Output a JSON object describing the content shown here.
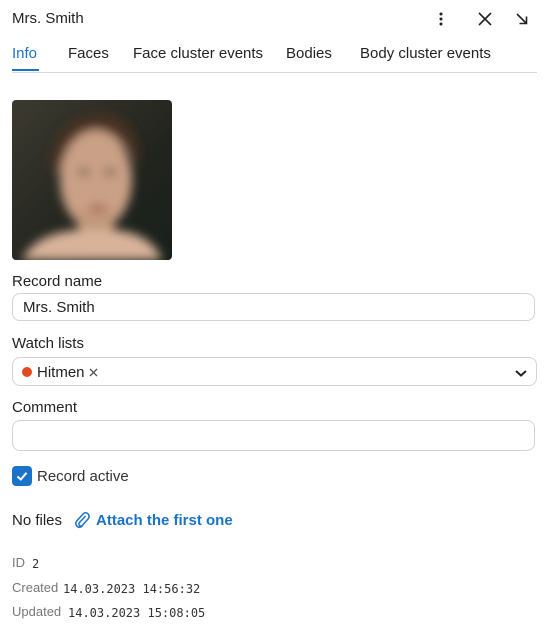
{
  "header": {
    "title": "Mrs. Smith"
  },
  "tabs": [
    {
      "label": "Info"
    },
    {
      "label": "Faces"
    },
    {
      "label": "Face cluster events"
    },
    {
      "label": "Bodies"
    },
    {
      "label": "Body cluster events"
    }
  ],
  "form": {
    "record_name_label": "Record name",
    "record_name_value": "Mrs. Smith",
    "watch_lists_label": "Watch lists",
    "watch_list_chip": {
      "label": "Hitmen",
      "color": "#e24a1f"
    },
    "comment_label": "Comment",
    "comment_value": "",
    "record_active_label": "Record active",
    "record_active_checked": true
  },
  "files": {
    "status": "No files",
    "attach_link": "Attach the first one"
  },
  "meta": {
    "id_label": "ID",
    "id_value": "2",
    "created_label": "Created",
    "created_value": "14.03.2023 14:56:32",
    "updated_label": "Updated",
    "updated_value": "14.03.2023 15:08:05"
  },
  "colors": {
    "accent": "#1a73c9",
    "border": "#cfd4da"
  },
  "icons": [
    "more-vert-icon",
    "close-icon",
    "expand-icon",
    "chip-remove-icon",
    "chevron-down-icon",
    "check-icon",
    "paperclip-icon"
  ]
}
